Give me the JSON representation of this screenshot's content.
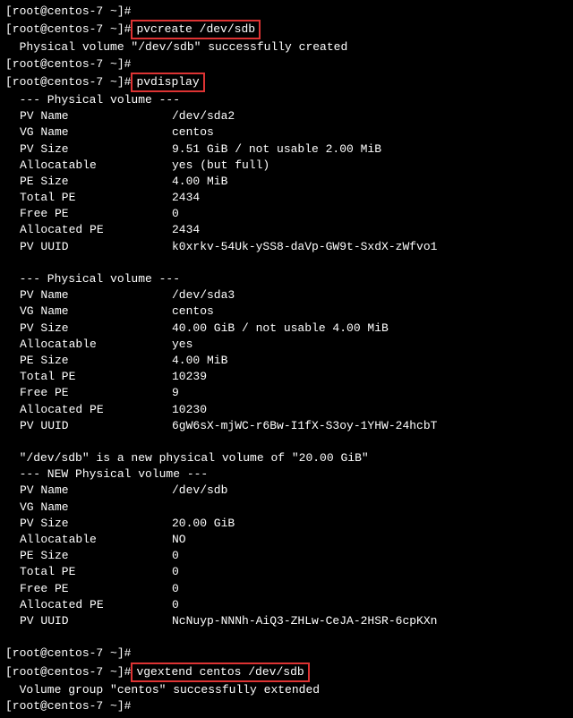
{
  "prompt": "[root@centos-7 ~]#",
  "prompt_space": " ",
  "cmd1": "pvcreate /dev/sdb",
  "msg1": "  Physical volume \"/dev/sdb\" successfully created",
  "cmd2": "pvdisplay",
  "pv_header": "  --- Physical volume ---",
  "pv1": {
    "name_lbl": "PV Name",
    "name_val": "/dev/sda2",
    "vg_lbl": "VG Name",
    "vg_val": "centos",
    "size_lbl": "PV Size",
    "size_val": "9.51 GiB / not usable 2.00 MiB",
    "alloc_lbl": "Allocatable",
    "alloc_val": "yes (but full)",
    "pes_lbl": "PE Size",
    "pes_val": "4.00 MiB",
    "tpe_lbl": "Total PE",
    "tpe_val": "2434",
    "fpe_lbl": "Free PE",
    "fpe_val": "0",
    "ape_lbl": "Allocated PE",
    "ape_val": "2434",
    "uuid_lbl": "PV UUID",
    "uuid_val": "k0xrkv-54Uk-ySS8-daVp-GW9t-SxdX-zWfvo1"
  },
  "pv2": {
    "name_lbl": "PV Name",
    "name_val": "/dev/sda3",
    "vg_lbl": "VG Name",
    "vg_val": "centos",
    "size_lbl": "PV Size",
    "size_val": "40.00 GiB / not usable 4.00 MiB",
    "alloc_lbl": "Allocatable",
    "alloc_val": "yes",
    "pes_lbl": "PE Size",
    "pes_val": "4.00 MiB",
    "tpe_lbl": "Total PE",
    "tpe_val": "10239",
    "fpe_lbl": "Free PE",
    "fpe_val": "9",
    "ape_lbl": "Allocated PE",
    "ape_val": "10230",
    "uuid_lbl": "PV UUID",
    "uuid_val": "6gW6sX-mjWC-r6Bw-I1fX-S3oy-1YHW-24hcbT"
  },
  "newpv_msg": "  \"/dev/sdb\" is a new physical volume of \"20.00 GiB\"",
  "newpv_header": "  --- NEW Physical volume ---",
  "pv3": {
    "name_lbl": "PV Name",
    "name_val": "/dev/sdb",
    "vg_lbl": "VG Name",
    "vg_val": "",
    "size_lbl": "PV Size",
    "size_val": "20.00 GiB",
    "alloc_lbl": "Allocatable",
    "alloc_val": "NO",
    "pes_lbl": "PE Size",
    "pes_val": "0",
    "tpe_lbl": "Total PE",
    "tpe_val": "0",
    "fpe_lbl": "Free PE",
    "fpe_val": "0",
    "ape_lbl": "Allocated PE",
    "ape_val": "0",
    "uuid_lbl": "PV UUID",
    "uuid_val": "NcNuyp-NNNh-AiQ3-ZHLw-CeJA-2HSR-6cpKXn"
  },
  "cmd3": "vgextend centos /dev/sdb",
  "msg3": "  Volume group \"centos\" successfully extended"
}
